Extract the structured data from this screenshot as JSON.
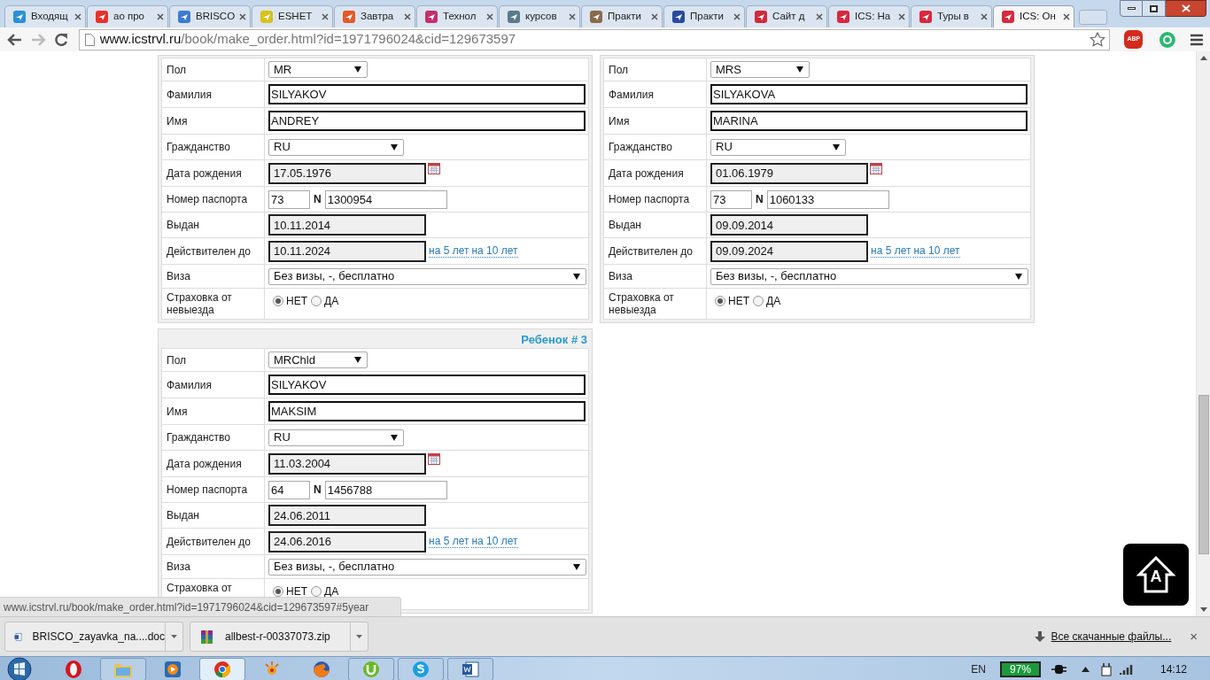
{
  "browser": {
    "tabs": [
      {
        "title": "Входящ",
        "color": "#2a8fd8",
        "selected": false
      },
      {
        "title": "ао про",
        "color": "#e8302a",
        "selected": false
      },
      {
        "title": "BRISCO",
        "color": "#3b7bd0",
        "selected": false
      },
      {
        "title": "ESHET",
        "color": "#d8c21a",
        "selected": false
      },
      {
        "title": "Завтра",
        "color": "#e05a2a",
        "selected": false
      },
      {
        "title": "Технол",
        "color": "#c2306e",
        "selected": false
      },
      {
        "title": "курсов",
        "color": "#5a7a8a",
        "selected": false
      },
      {
        "title": "Практи",
        "color": "#8a6a4a",
        "selected": false
      },
      {
        "title": "Практи",
        "color": "#2a4aa0",
        "selected": false
      },
      {
        "title": "Сайт д",
        "color": "#d02a3a",
        "selected": false
      },
      {
        "title": "ICS: На",
        "color": "#d8283e",
        "selected": false
      },
      {
        "title": "Туры в",
        "color": "#d8283e",
        "selected": false
      },
      {
        "title": "ICS: Он",
        "color": "#d8283e",
        "selected": true
      }
    ],
    "address": {
      "host": "www.icstrvl.ru",
      "path": "/book/make_order.html?id=1971796024&cid=129673597"
    },
    "adblock_label": "ABP"
  },
  "passengers": [
    {
      "rows": [
        {
          "kind": "title",
          "label": "Пол",
          "value": "MR"
        },
        {
          "kind": "name",
          "label": "Фамилия",
          "value": "SILYAKOV"
        },
        {
          "kind": "name",
          "label": "Имя",
          "value": "ANDREY"
        },
        {
          "kind": "country",
          "label": "Гражданство",
          "value": "RU"
        },
        {
          "kind": "date",
          "label": "Дата рождения",
          "value": "17.05.1976"
        },
        {
          "kind": "passport",
          "label": "Номер паспорта",
          "series": "73",
          "separator": "N",
          "number": "1300954"
        },
        {
          "kind": "issued",
          "label": "Выдан",
          "value": "10.11.2014"
        },
        {
          "kind": "expiry",
          "label": "Действителен до",
          "value": "10.11.2024",
          "links": [
            "на 5 лет",
            "на 10 лет"
          ]
        },
        {
          "kind": "visa",
          "label": "Виза",
          "value": "Без визы, -, бесплатно"
        },
        {
          "kind": "insurance",
          "label": "Страховка от невыезда",
          "options": [
            {
              "label": "НЕТ",
              "selected": true
            },
            {
              "label": "ДА",
              "selected": false
            }
          ]
        }
      ]
    },
    {
      "rows": [
        {
          "kind": "title",
          "label": "Пол",
          "value": "MRS"
        },
        {
          "kind": "name",
          "label": "Фамилия",
          "value": "SILYAKOVA"
        },
        {
          "kind": "name",
          "label": "Имя",
          "value": "MARINA"
        },
        {
          "kind": "country",
          "label": "Гражданство",
          "value": "RU"
        },
        {
          "kind": "date",
          "label": "Дата рождения",
          "value": "01.06.1979"
        },
        {
          "kind": "passport",
          "label": "Номер паспорта",
          "series": "73",
          "separator": "N",
          "number": "1060133"
        },
        {
          "kind": "issued",
          "label": "Выдан",
          "value": "09.09.2014"
        },
        {
          "kind": "expiry",
          "label": "Действителен до",
          "value": "09.09.2024",
          "links": [
            "на 5 лет",
            "на 10 лет"
          ]
        },
        {
          "kind": "visa",
          "label": "Виза",
          "value": "Без визы, -, бесплатно"
        },
        {
          "kind": "insurance",
          "label": "Страховка от невыезда",
          "options": [
            {
              "label": "НЕТ",
              "selected": true
            },
            {
              "label": "ДА",
              "selected": false
            }
          ]
        }
      ]
    },
    {
      "heading": "Ребенок # 3",
      "rows": [
        {
          "kind": "title",
          "label": "Пол",
          "value": "MRChld"
        },
        {
          "kind": "name",
          "label": "Фамилия",
          "value": "SILYAKOV"
        },
        {
          "kind": "name",
          "label": "Имя",
          "value": "MAKSIM"
        },
        {
          "kind": "country",
          "label": "Гражданство",
          "value": "RU"
        },
        {
          "kind": "date",
          "label": "Дата рождения",
          "value": "11.03.2004"
        },
        {
          "kind": "passport",
          "label": "Номер паспорта",
          "series": "64",
          "separator": "N",
          "number": "1456788"
        },
        {
          "kind": "issued",
          "label": "Выдан",
          "value": "24.06.2011"
        },
        {
          "kind": "expiry",
          "label": "Действителен до",
          "value": "24.06.2016",
          "links": [
            "на 5 лет",
            "на 10 лет"
          ]
        },
        {
          "kind": "visa",
          "label": "Виза",
          "value": "Без визы, -, бесплатно"
        },
        {
          "kind": "insurance",
          "label": "Страховка от",
          "options": [
            {
              "label": "НЕТ",
              "selected": true
            },
            {
              "label": "ДА",
              "selected": false
            }
          ]
        }
      ]
    }
  ],
  "accessibility_button": {
    "letter": "A"
  },
  "status_url": "www.icstrvl.ru/book/make_order.html?id=1971796024&cid=129673597#5year",
  "downloads": {
    "items": [
      {
        "name": "BRISCO_zayavka_na....doc",
        "kind": "word"
      },
      {
        "name": "allbest-r-00337073.zip",
        "kind": "archive"
      }
    ],
    "show_all": "Все скачанные файлы...",
    "close": "×"
  },
  "taskbar": {
    "apps": [
      {
        "kind": "opera",
        "open": false,
        "selected": false
      },
      {
        "kind": "explorer",
        "open": true,
        "selected": false
      },
      {
        "kind": "media",
        "open": false,
        "selected": false
      },
      {
        "kind": "chrome",
        "open": true,
        "selected": true
      },
      {
        "kind": "game",
        "open": false,
        "selected": false
      },
      {
        "kind": "firefox",
        "open": false,
        "selected": false
      },
      {
        "kind": "torrent",
        "open": true,
        "selected": false
      },
      {
        "kind": "skype",
        "open": true,
        "selected": false
      },
      {
        "kind": "word",
        "open": true,
        "selected": false
      }
    ],
    "language": "EN",
    "battery": "97%",
    "clock": "14:12"
  }
}
